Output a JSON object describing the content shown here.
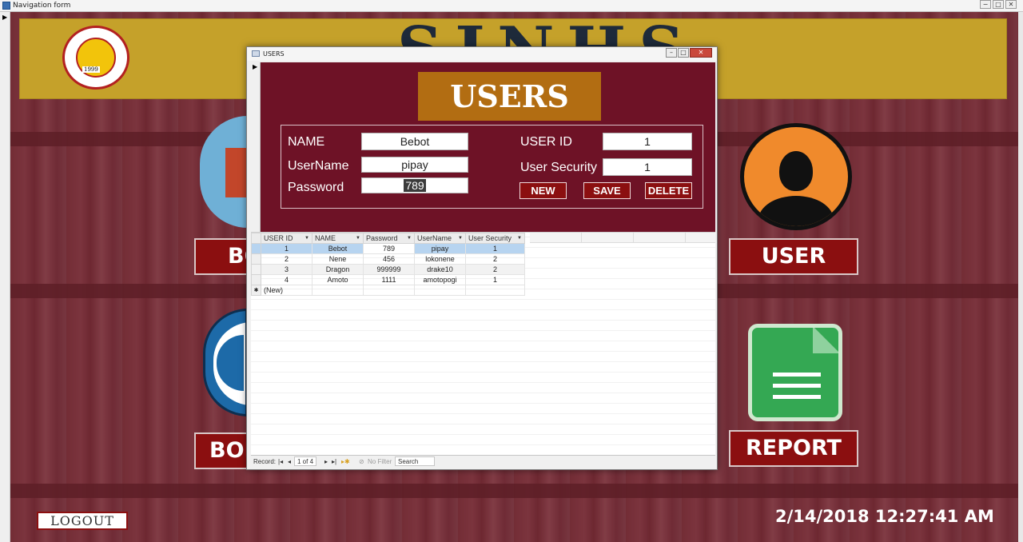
{
  "window": {
    "title": "Navigation form",
    "controls": [
      "−",
      "□",
      "✕"
    ]
  },
  "header": {
    "school_logo_year": "1999",
    "title": "SJNHS"
  },
  "menu": {
    "book_label": "BOOK",
    "borrow_label": "BORROW",
    "user_label": "USER",
    "report_label": "REPORT",
    "logout_label": "LOGOUT"
  },
  "clock": "2/14/2018 12:27:41 AM",
  "dialog": {
    "title": "USERS",
    "controls": [
      "–",
      "□",
      "✕"
    ],
    "heading": "USERS",
    "form": {
      "name_label": "NAME",
      "name_value": "Bebot",
      "username_label": "UserName",
      "username_value": "pipay",
      "password_label": "Password",
      "password_value": "789",
      "userid_label": "USER ID",
      "userid_value": "1",
      "usersec_label": "User Security",
      "usersec_value": "1",
      "new_label": "NEW",
      "save_label": "SAVE",
      "delete_label": "DELETE"
    },
    "table": {
      "columns": [
        "USER ID",
        "NAME",
        "Password",
        "UserName",
        "User Security"
      ],
      "rows": [
        [
          "1",
          "Bebot",
          "789",
          "pipay",
          "1"
        ],
        [
          "2",
          "Nene",
          "456",
          "lokonene",
          "2"
        ],
        [
          "3",
          "Dragon",
          "999999",
          "drake10",
          "2"
        ],
        [
          "4",
          "Amoto",
          "1111",
          "amotopogi",
          "1"
        ]
      ],
      "new_row_marker": "✱",
      "new_row_label": "(New)"
    },
    "navigator": {
      "record_label": "Record:",
      "position": "1 of 4",
      "filter_label": "No Filter",
      "search_label": "Search"
    }
  },
  "colors": {
    "accent_maroon": "#8b0f10",
    "form_bg": "#6e1226",
    "title_gold": "#b26d12",
    "header_band": "#c5a12a",
    "user_orange": "#f08a2c",
    "report_green": "#34a853"
  },
  "icons": [
    "school-logo-icon",
    "user-avatar-icon",
    "report-sheet-icon",
    "book-icon",
    "borrow-icon"
  ]
}
